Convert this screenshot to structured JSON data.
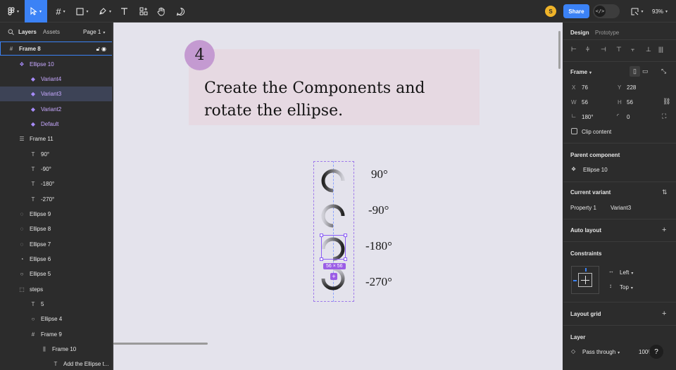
{
  "toolbar": {
    "zoom": "93%",
    "share_label": "Share",
    "avatar_initial": "S",
    "dev_mode_glyph": "</>"
  },
  "left_panel": {
    "tabs": {
      "layers": "Layers",
      "assets": "Assets"
    },
    "page": "Page 1",
    "layers": [
      {
        "label": "Frame 8",
        "icon": "frame-icon"
      },
      {
        "label": "Ellipse 10",
        "icon": "component-set-icon"
      },
      {
        "label": "Variant4",
        "icon": "variant-icon"
      },
      {
        "label": "Variant3",
        "icon": "variant-icon"
      },
      {
        "label": "Variant2",
        "icon": "variant-icon"
      },
      {
        "label": "Default",
        "icon": "variant-icon"
      },
      {
        "label": "Frame 11",
        "icon": "auto-layout-icon"
      },
      {
        "label": "90°",
        "icon": "text-icon"
      },
      {
        "label": "-90°",
        "icon": "text-icon"
      },
      {
        "label": "-180°",
        "icon": "text-icon"
      },
      {
        "label": "-270°",
        "icon": "text-icon"
      },
      {
        "label": "Ellipse 9",
        "icon": "arc-icon"
      },
      {
        "label": "Ellipse 8",
        "icon": "arc-icon"
      },
      {
        "label": "Ellipse 7",
        "icon": "arc-icon"
      },
      {
        "label": "Ellipse 6",
        "icon": "arc-icon"
      },
      {
        "label": "Ellipse 5",
        "icon": "ellipse-icon"
      },
      {
        "label": "steps",
        "icon": "section-icon"
      },
      {
        "label": "5",
        "icon": "text-icon"
      },
      {
        "label": "Ellipse 4",
        "icon": "ellipse-icon"
      },
      {
        "label": "Frame 9",
        "icon": "frame-icon"
      },
      {
        "label": "Frame 10",
        "icon": "auto-layout-icon"
      },
      {
        "label": "Add the Ellipse t...",
        "icon": "text-icon"
      }
    ]
  },
  "canvas": {
    "step_number": "4",
    "title": "Create the Components and rotate the ellipse.",
    "angles": [
      "90°",
      "-90°",
      "-180°",
      "-270°"
    ],
    "size_badge": "56 × 56",
    "plus_badge": "+"
  },
  "right_panel": {
    "tabs": {
      "design": "Design",
      "prototype": "Prototype"
    },
    "frame_label": "Frame",
    "x_label": "X",
    "x": "76",
    "y_label": "Y",
    "y": "228",
    "w_label": "W",
    "w": "56",
    "h_label": "H",
    "h": "56",
    "rotation": "180°",
    "radius": "0",
    "clip_content": "Clip content",
    "parent_component_heading": "Parent component",
    "parent_component": "Ellipse 10",
    "current_variant_heading": "Current variant",
    "property_label": "Property 1",
    "property_value": "Variant3",
    "auto_layout": "Auto layout",
    "constraints": "Constraints",
    "constraint_h": "Left",
    "constraint_v": "Top",
    "layout_grid": "Layout grid",
    "layer": "Layer",
    "blend": "Pass through",
    "opacity": "100%",
    "help": "?"
  },
  "colors": {
    "accent": "#3b82f6",
    "component_purple": "#a78bfa",
    "canvas_bg": "#e4e3ec",
    "card_bg": "#e6d9e2",
    "step_circle": "#c49ad1",
    "panel_bg": "#2c2c2c"
  }
}
